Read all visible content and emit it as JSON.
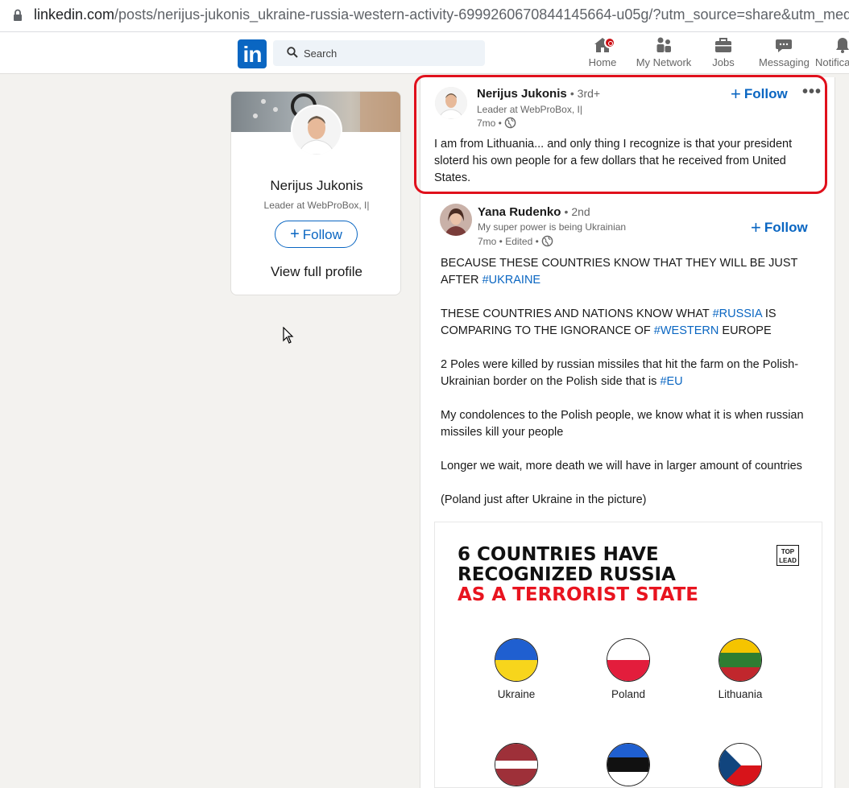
{
  "browser": {
    "url_host": "linkedin.com",
    "url_path": "/posts/nerijus-jukonis_ukraine-russia-western-activity-6999260670844145664-u05g/?utm_source=share&utm_medium"
  },
  "nav": {
    "logo": "in",
    "search_placeholder": "Search",
    "items": [
      {
        "label": "Home"
      },
      {
        "label": "My Network"
      },
      {
        "label": "Jobs"
      },
      {
        "label": "Messaging"
      },
      {
        "label": "Notifica"
      }
    ]
  },
  "profile_card": {
    "name": "Nerijus Jukonis",
    "headline": "Leader at WebProBox, I|",
    "follow_label": "Follow",
    "view_profile_label": "View full profile"
  },
  "comments": [
    {
      "author": "Nerijus Jukonis",
      "degree": "• 3rd+",
      "headline": "Leader at WebProBox, I|",
      "meta": "7mo •",
      "follow_label": "Follow",
      "more": "•••",
      "text": "I am from Lithuania... and only thing I recognize is that your president sloterd his own people for a few dollars that he received from United States."
    },
    {
      "author": "Yana Rudenko",
      "degree": "• 2nd",
      "headline": "My super power is being Ukrainian",
      "meta": "7mo • Edited •",
      "follow_label": "Follow",
      "p1_a": "BECAUSE THESE COUNTRIES KNOW THAT THEY WILL BE JUST AFTER ",
      "p1_tag": "#UKRAINE",
      "p2_a": "THESE COUNTRIES AND NATIONS KNOW WHAT ",
      "p2_tag1": "#RUSSIA",
      "p2_b": " IS COMPARING TO THE IGNORANCE OF ",
      "p2_tag2": "#WESTERN",
      "p2_c": " EUROPE",
      "p3_a": "2 Poles were killed by russian missiles that hit the farm on the Polish-Ukrainian border on the Polish side that is ",
      "p3_tag": "#EU",
      "p4": "My condolences to the Polish people, we know what it is when russian missiles kill your people",
      "p5": "Longer we wait, more death we will have in larger amount of countries",
      "p6": "(Poland just after Ukraine in the picture)"
    }
  ],
  "graphic": {
    "title_line1": "6 COUNTRIES HAVE",
    "title_line2": "RECOGNIZED RUSSIA",
    "title_line3": "AS A TERRORIST STATE",
    "badge_top": "TOP",
    "badge_bottom": "LEAD",
    "countries": [
      "Ukraine",
      "Poland",
      "Lithuania"
    ]
  }
}
